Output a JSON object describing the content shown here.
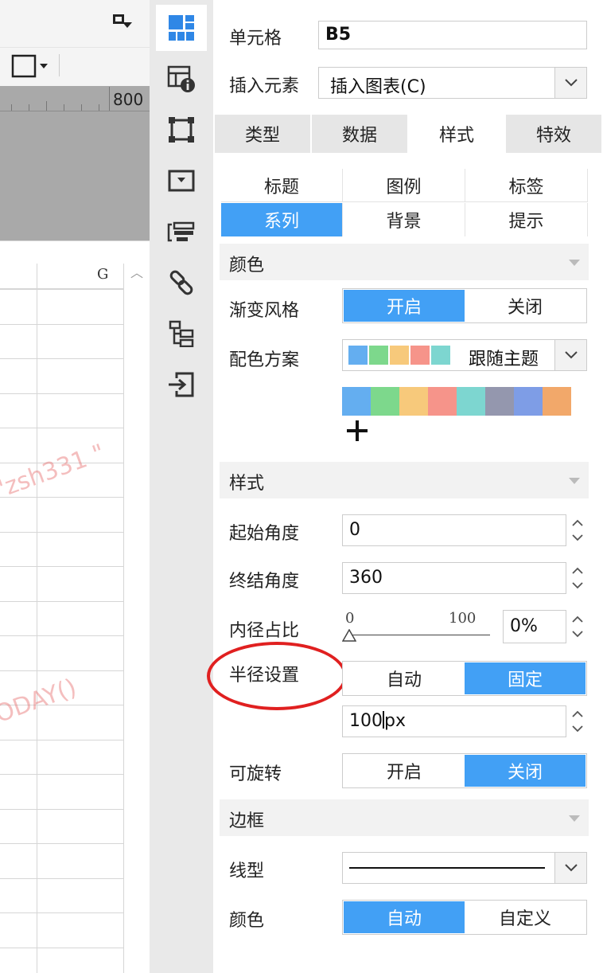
{
  "spreadsheet": {
    "ruler_number": "800",
    "column_label": "G",
    "watermark_1": "\"zsh331 \"",
    "watermark_2": "ODAY()"
  },
  "panel": {
    "cell": {
      "label": "单元格",
      "value": "B5"
    },
    "insert": {
      "label": "插入元素",
      "value": "插入图表(C)"
    },
    "tabs": [
      "类型",
      "数据",
      "样式",
      "特效"
    ],
    "active_tab": "样式",
    "subtabs": [
      "标题",
      "图例",
      "标签",
      "系列",
      "背景",
      "提示"
    ],
    "active_subtab": "系列",
    "color_section": {
      "title": "颜色",
      "gradient": {
        "label": "渐变风格",
        "on": "开启",
        "off": "关闭",
        "selected": "开启"
      },
      "scheme": {
        "label": "配色方案",
        "value": "跟随主题"
      },
      "palette": [
        "#64aef0",
        "#7dd88c",
        "#f7c97b",
        "#f6948a",
        "#7dd6d0",
        "#9497ae",
        "#7e9de6",
        "#f2a86a"
      ],
      "mini_palette": [
        "#64aef0",
        "#7dd88c",
        "#f7c97b",
        "#f6948a",
        "#7dd6d0"
      ]
    },
    "style_section": {
      "title": "样式",
      "start_angle": {
        "label": "起始角度",
        "value": "0"
      },
      "end_angle": {
        "label": "终结角度",
        "value": "360"
      },
      "inner_ratio": {
        "label": "内径占比",
        "min": "0",
        "max": "100",
        "value": "0%"
      },
      "radius": {
        "label": "半径设置",
        "auto": "自动",
        "fixed": "固定",
        "selected": "固定",
        "value_before_cursor": "100",
        "value_after_cursor": "px"
      },
      "rotatable": {
        "label": "可旋转",
        "on": "开启",
        "off": "关闭",
        "selected": "关闭"
      }
    },
    "border_section": {
      "title": "边框",
      "line_type": {
        "label": "线型"
      },
      "color": {
        "label": "颜色",
        "auto": "自动",
        "custom": "自定义",
        "selected": "自动"
      }
    }
  },
  "colors": {
    "accent": "#42a0f5",
    "icon": "#2f87e6",
    "annotation": "#e02020"
  }
}
